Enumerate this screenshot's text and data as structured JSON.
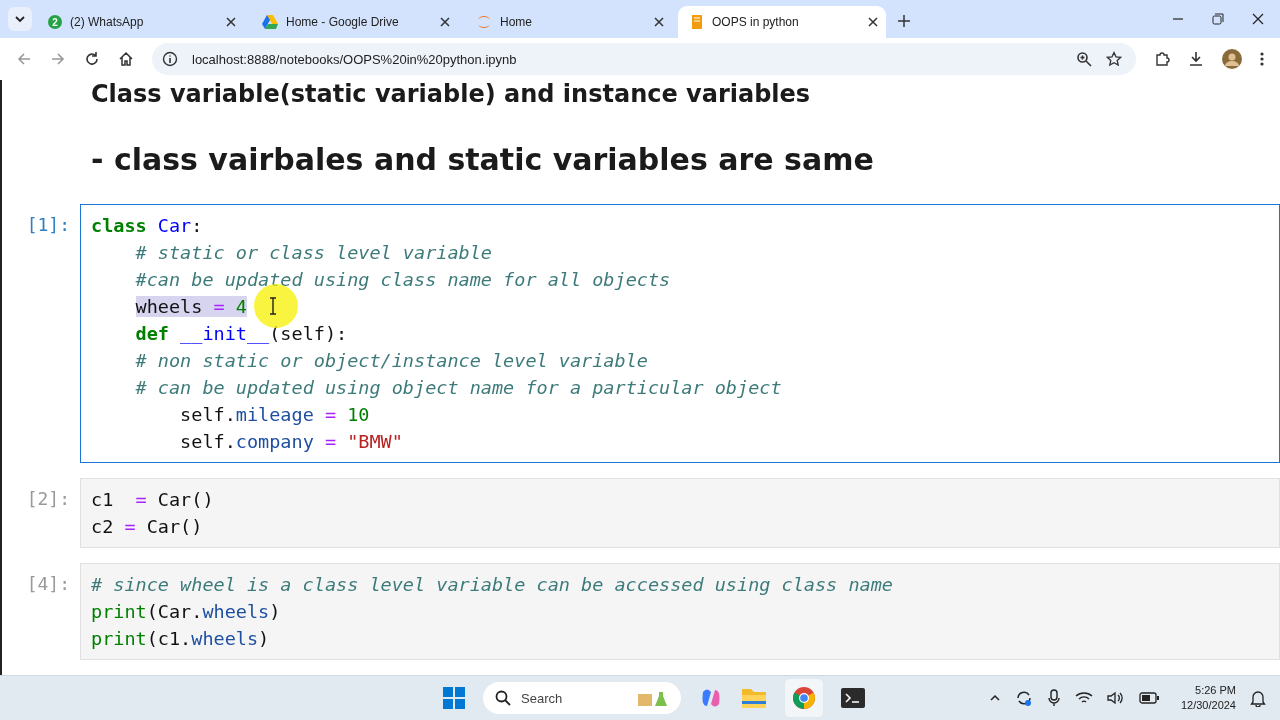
{
  "browser": {
    "tabs": [
      {
        "title": "(2) WhatsApp",
        "badge": "2",
        "selected": false
      },
      {
        "title": "Home - Google Drive",
        "selected": false
      },
      {
        "title": "Home",
        "selected": false
      },
      {
        "title": "OOPS in python",
        "selected": true
      }
    ],
    "url": "localhost:8888/notebooks/OOPS%20in%20python.ipynb"
  },
  "notebook": {
    "headings": [
      "Class variable(static variable) and instance variables",
      "- class vairbales and static variables are same"
    ],
    "cells": [
      {
        "prompt": "[1]:",
        "selected": true,
        "lines": [
          {
            "selected": false,
            "tokens": [
              {
                "t": "class",
                "kind": "kw"
              },
              {
                "t": " Car",
                "kind": "def"
              },
              {
                "t": ":",
                "kind": "plain"
              }
            ]
          },
          {
            "selected": false,
            "tokens": [
              {
                "t": "    # static or class level variable",
                "kind": "cm"
              }
            ]
          },
          {
            "selected": false,
            "tokens": [
              {
                "t": "    #can be updated using class name for all objects",
                "kind": "cm"
              }
            ]
          },
          {
            "selected": true,
            "tokens": [
              {
                "t": "    wheels ",
                "kind": "plain"
              },
              {
                "t": "=",
                "kind": "op"
              },
              {
                "t": " 4",
                "kind": "num"
              }
            ]
          },
          {
            "selected": false,
            "tokens": [
              {
                "t": "    def",
                "kind": "kw"
              },
              {
                "t": " __init__",
                "kind": "def"
              },
              {
                "t": "(self):",
                "kind": "plain"
              }
            ]
          },
          {
            "selected": false,
            "tokens": [
              {
                "t": "    # non static or object/instance level variable",
                "kind": "cm"
              }
            ]
          },
          {
            "selected": false,
            "tokens": [
              {
                "t": "    # can be updated using object name for a particular object",
                "kind": "cm"
              }
            ]
          },
          {
            "selected": false,
            "tokens": [
              {
                "t": "        self.",
                "kind": "plain"
              },
              {
                "t": "mileage",
                "kind": "attr"
              },
              {
                "t": " =",
                "kind": "op"
              },
              {
                "t": " 10",
                "kind": "num"
              }
            ]
          },
          {
            "selected": false,
            "tokens": [
              {
                "t": "        self.",
                "kind": "plain"
              },
              {
                "t": "company",
                "kind": "attr"
              },
              {
                "t": " =",
                "kind": "op"
              },
              {
                "t": " \"BMW\"",
                "kind": "str"
              }
            ]
          }
        ]
      },
      {
        "prompt": "[2]:",
        "selected": false,
        "lines": [
          {
            "selected": false,
            "tokens": [
              {
                "t": "c1  ",
                "kind": "plain"
              },
              {
                "t": "=",
                "kind": "op"
              },
              {
                "t": " Car()",
                "kind": "plain"
              }
            ]
          },
          {
            "selected": false,
            "tokens": [
              {
                "t": "c2 ",
                "kind": "plain"
              },
              {
                "t": "=",
                "kind": "op"
              },
              {
                "t": " Car()",
                "kind": "plain"
              }
            ]
          }
        ]
      },
      {
        "prompt": "[4]:",
        "selected": false,
        "lines": [
          {
            "selected": false,
            "tokens": [
              {
                "t": "# since wheel is a class level variable can be accessed using class name",
                "kind": "cm"
              }
            ]
          },
          {
            "selected": false,
            "tokens": [
              {
                "t": "print",
                "kind": "bi"
              },
              {
                "t": "(Car.",
                "kind": "plain"
              },
              {
                "t": "wheels",
                "kind": "attr"
              },
              {
                "t": ")",
                "kind": "plain"
              }
            ]
          },
          {
            "selected": false,
            "tokens": [
              {
                "t": "print",
                "kind": "bi"
              },
              {
                "t": "(c1.",
                "kind": "plain"
              },
              {
                "t": "wheels",
                "kind": "attr"
              },
              {
                "t": ")",
                "kind": "plain"
              }
            ]
          }
        ]
      }
    ]
  },
  "taskbar": {
    "search_placeholder": "Search",
    "time": "5:26 PM",
    "date": "12/30/2024"
  }
}
